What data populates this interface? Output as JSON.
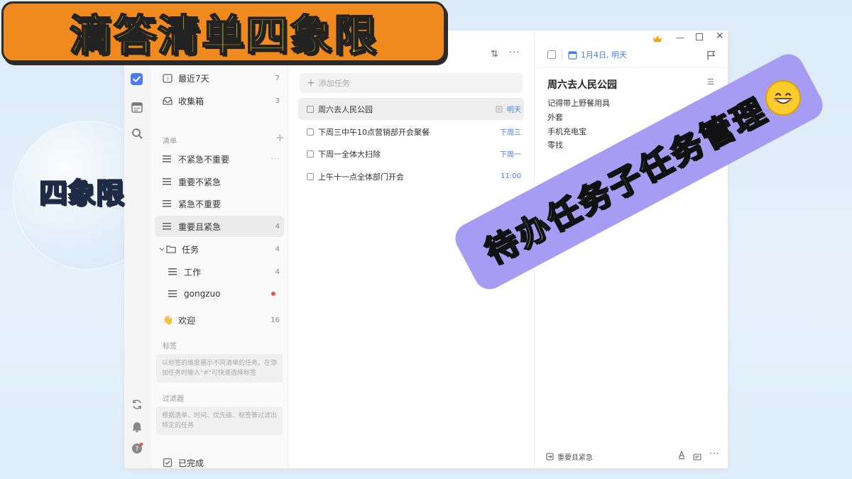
{
  "overlays": {
    "banner_title": "滴答清单四象限",
    "bubble_label": "四象限",
    "ribbon_label": "待办任务子任务管理"
  },
  "sidebar": {
    "items": [
      {
        "label": "最近7天",
        "count": "7"
      },
      {
        "label": "收集箱",
        "count": "3"
      }
    ],
    "lists_title": "清单",
    "lists": [
      {
        "label": "不紧急不重要",
        "count": ""
      },
      {
        "label": "重要不紧急",
        "count": ""
      },
      {
        "label": "紧急不重要",
        "count": ""
      },
      {
        "label": "重要且紧急",
        "count": "4"
      }
    ],
    "folder": {
      "label": "任务",
      "count": "4"
    },
    "folder_children": [
      {
        "label": "工作",
        "count": "4"
      },
      {
        "label": "gongzuo",
        "count": ""
      }
    ],
    "welcome": {
      "label": "欢迎",
      "count": "16"
    },
    "tags_title": "标签",
    "tags_hint": "以标签的维度展示不同清单的任务。在添加任务时输入\"#\"可快速选择标签",
    "filters_title": "过滤器",
    "filters_hint": "根据清单、时间、优先级、标签等过滤出特定的任务",
    "completed": "已完成"
  },
  "tasklist": {
    "add_placeholder": "添加任务",
    "tasks": [
      {
        "title": "周六去人民公园",
        "due": "明天"
      },
      {
        "title": "下周三中午10点营销部开会聚餐",
        "due": "下周三"
      },
      {
        "title": "下周一全体大扫除",
        "due": "下周一"
      },
      {
        "title": "上午十一点全体部门开会",
        "due": "11:00"
      }
    ]
  },
  "detail": {
    "date": "1月4日, 明天",
    "title": "周六去人民公园",
    "notes": [
      "记得带上野餐用具",
      "外套",
      "手机充电宝",
      "零找"
    ],
    "list_name": "重要且紧急"
  },
  "colors": {
    "accent": "#4a7cf0",
    "banner_bg": "#f08a1f",
    "banner_text": "#ffe21f",
    "ribbon_bg": "#a69cf3",
    "crown": "#f2a516",
    "red_dot": "#e9534f"
  },
  "icons": [
    "checkbox-icon",
    "calendar-icon",
    "search-icon",
    "sync-icon",
    "bell-icon",
    "help-icon",
    "crown-icon",
    "flag-icon",
    "sort-icon",
    "more-icon",
    "inbox-icon",
    "folder-icon",
    "wave-hand-icon",
    "emoji-grin-icon"
  ]
}
